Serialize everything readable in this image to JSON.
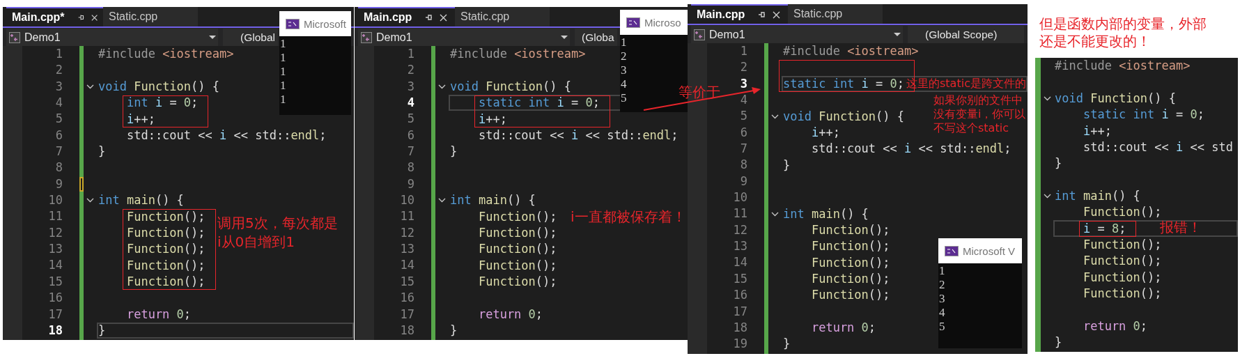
{
  "panels": [
    {
      "kind": "editor",
      "tabs": [
        {
          "label": "Main.cpp*",
          "selected": true
        },
        {
          "label": "Static.cpp",
          "selected": false
        }
      ],
      "project": "Demo1",
      "scope": "(Global",
      "console": {
        "title": "Microsoft",
        "output": [
          "1",
          "1",
          "1",
          "1",
          "1"
        ]
      },
      "lines": [
        {
          "number": "1",
          "current": false,
          "fold": false,
          "boxed": false,
          "unsaved": false,
          "tokens": [
            {
              "kind": "preprocessor",
              "text": "#include "
            },
            {
              "kind": "string",
              "text": "<iostream>"
            }
          ]
        },
        {
          "number": "2",
          "current": false,
          "fold": false,
          "boxed": false,
          "unsaved": false
        },
        {
          "number": "3",
          "current": false,
          "fold": true,
          "boxed": false,
          "unsaved": false,
          "tokens": [
            {
              "kind": "keyword",
              "text": "void "
            },
            {
              "kind": "function",
              "text": "Function"
            },
            {
              "kind": "plain",
              "text": "() {"
            }
          ]
        },
        {
          "number": "4",
          "current": false,
          "fold": false,
          "boxed": true,
          "unsaved": false,
          "tokens": [
            {
              "kind": "keyword",
              "text": "    int "
            },
            {
              "kind": "variable",
              "text": "i"
            },
            {
              "kind": "plain",
              "text": " = "
            },
            {
              "kind": "number",
              "text": "0"
            },
            {
              "kind": "plain",
              "text": ";"
            }
          ]
        },
        {
          "number": "5",
          "current": false,
          "fold": false,
          "boxed": true,
          "unsaved": false,
          "tokens": [
            {
              "kind": "variable",
              "text": "    i"
            },
            {
              "kind": "plain",
              "text": "++;"
            }
          ]
        },
        {
          "number": "6",
          "current": false,
          "fold": false,
          "boxed": false,
          "unsaved": false,
          "tokens": [
            {
              "kind": "plain",
              "text": "    std::cout << "
            },
            {
              "kind": "variable",
              "text": "i"
            },
            {
              "kind": "plain",
              "text": " << std::"
            },
            {
              "kind": "function",
              "text": "endl"
            },
            {
              "kind": "plain",
              "text": ";"
            }
          ]
        },
        {
          "number": "7",
          "current": false,
          "fold": false,
          "boxed": false,
          "unsaved": false,
          "tokens": [
            {
              "kind": "plain",
              "text": "}"
            }
          ]
        },
        {
          "number": "8",
          "current": false,
          "fold": false,
          "boxed": false,
          "unsaved": false
        },
        {
          "number": "9",
          "current": false,
          "fold": false,
          "boxed": false,
          "unsaved": true
        },
        {
          "number": "10",
          "current": false,
          "fold": true,
          "boxed": false,
          "unsaved": false,
          "tokens": [
            {
              "kind": "keyword",
              "text": "int "
            },
            {
              "kind": "function",
              "text": "main"
            },
            {
              "kind": "plain",
              "text": "() {"
            }
          ]
        },
        {
          "number": "11",
          "current": false,
          "fold": false,
          "boxed": true,
          "unsaved": false,
          "tokens": [
            {
              "kind": "function",
              "text": "    Function"
            },
            {
              "kind": "plain",
              "text": "();"
            }
          ],
          "note": "调用5次，每次都是i从0自增到1"
        },
        {
          "number": "12",
          "current": false,
          "fold": false,
          "boxed": true,
          "unsaved": false,
          "tokens": [
            {
              "kind": "function",
              "text": "    Function"
            },
            {
              "kind": "plain",
              "text": "();"
            }
          ]
        },
        {
          "number": "13",
          "current": false,
          "fold": false,
          "boxed": true,
          "unsaved": false,
          "tokens": [
            {
              "kind": "function",
              "text": "    Function"
            },
            {
              "kind": "plain",
              "text": "();"
            }
          ]
        },
        {
          "number": "14",
          "current": false,
          "fold": false,
          "boxed": true,
          "unsaved": false,
          "tokens": [
            {
              "kind": "function",
              "text": "    Function"
            },
            {
              "kind": "plain",
              "text": "();"
            }
          ]
        },
        {
          "number": "15",
          "current": false,
          "fold": false,
          "boxed": true,
          "unsaved": false,
          "tokens": [
            {
              "kind": "function",
              "text": "    Function"
            },
            {
              "kind": "plain",
              "text": "();"
            }
          ]
        },
        {
          "number": "16",
          "current": false,
          "fold": false,
          "boxed": false,
          "unsaved": false
        },
        {
          "number": "17",
          "current": false,
          "fold": false,
          "boxed": false,
          "unsaved": false,
          "tokens": [
            {
              "kind": "control",
              "text": "    return "
            },
            {
              "kind": "number",
              "text": "0"
            },
            {
              "kind": "plain",
              "text": ";"
            }
          ]
        },
        {
          "number": "18",
          "current": true,
          "fold": false,
          "boxed": false,
          "unsaved": false,
          "tokens": [
            {
              "kind": "plain",
              "text": "}"
            }
          ]
        }
      ]
    },
    {
      "kind": "editor",
      "tabs": [
        {
          "label": "Main.cpp",
          "selected": true
        },
        {
          "label": "Static.cpp",
          "selected": false
        }
      ],
      "project": "Demo1",
      "scope": "(Globa",
      "console": {
        "title": "Microso",
        "output": [
          "1",
          "2",
          "3",
          "4",
          "5"
        ]
      },
      "lines": [
        {
          "number": "1",
          "current": false,
          "fold": false,
          "boxed": false,
          "unsaved": false,
          "tokens": [
            {
              "kind": "preprocessor",
              "text": "#include "
            },
            {
              "kind": "string",
              "text": "<iostream>"
            }
          ]
        },
        {
          "number": "2",
          "current": false,
          "fold": false,
          "boxed": false,
          "unsaved": false
        },
        {
          "number": "3",
          "current": false,
          "fold": true,
          "boxed": false,
          "unsaved": false,
          "tokens": [
            {
              "kind": "keyword",
              "text": "void "
            },
            {
              "kind": "function",
              "text": "Function"
            },
            {
              "kind": "plain",
              "text": "() {"
            }
          ]
        },
        {
          "number": "4",
          "current": true,
          "fold": false,
          "boxed": true,
          "unsaved": false,
          "tokens": [
            {
              "kind": "keyword",
              "text": "    static int "
            },
            {
              "kind": "variable",
              "text": "i"
            },
            {
              "kind": "plain",
              "text": " = "
            },
            {
              "kind": "number",
              "text": "0"
            },
            {
              "kind": "plain",
              "text": ";"
            }
          ]
        },
        {
          "number": "5",
          "current": false,
          "fold": false,
          "boxed": true,
          "unsaved": false,
          "tokens": [
            {
              "kind": "variable",
              "text": "    i"
            },
            {
              "kind": "plain",
              "text": "++;"
            }
          ]
        },
        {
          "number": "6",
          "current": false,
          "fold": false,
          "boxed": false,
          "unsaved": false,
          "tokens": [
            {
              "kind": "plain",
              "text": "    std::cout << "
            },
            {
              "kind": "variable",
              "text": "i"
            },
            {
              "kind": "plain",
              "text": " << std::"
            },
            {
              "kind": "function",
              "text": "endl"
            },
            {
              "kind": "plain",
              "text": ";"
            }
          ]
        },
        {
          "number": "7",
          "current": false,
          "fold": false,
          "boxed": false,
          "unsaved": false,
          "tokens": [
            {
              "kind": "plain",
              "text": "}"
            }
          ]
        },
        {
          "number": "8",
          "current": false,
          "fold": false,
          "boxed": false,
          "unsaved": false
        },
        {
          "number": "9",
          "current": false,
          "fold": false,
          "boxed": false,
          "unsaved": false
        },
        {
          "number": "10",
          "current": false,
          "fold": true,
          "boxed": false,
          "unsaved": false,
          "tokens": [
            {
              "kind": "keyword",
              "text": "int "
            },
            {
              "kind": "function",
              "text": "main"
            },
            {
              "kind": "plain",
              "text": "() {"
            }
          ]
        },
        {
          "number": "11",
          "current": false,
          "fold": false,
          "boxed": false,
          "unsaved": false,
          "tokens": [
            {
              "kind": "function",
              "text": "    Function"
            },
            {
              "kind": "plain",
              "text": "();"
            }
          ],
          "note": "i一直都被保存着！"
        },
        {
          "number": "12",
          "current": false,
          "fold": false,
          "boxed": false,
          "unsaved": false,
          "tokens": [
            {
              "kind": "function",
              "text": "    Function"
            },
            {
              "kind": "plain",
              "text": "();"
            }
          ]
        },
        {
          "number": "13",
          "current": false,
          "fold": false,
          "boxed": false,
          "unsaved": false,
          "tokens": [
            {
              "kind": "function",
              "text": "    Function"
            },
            {
              "kind": "plain",
              "text": "();"
            }
          ]
        },
        {
          "number": "14",
          "current": false,
          "fold": false,
          "boxed": false,
          "unsaved": false,
          "tokens": [
            {
              "kind": "function",
              "text": "    Function"
            },
            {
              "kind": "plain",
              "text": "();"
            }
          ]
        },
        {
          "number": "15",
          "current": false,
          "fold": false,
          "boxed": false,
          "unsaved": false,
          "tokens": [
            {
              "kind": "function",
              "text": "    Function"
            },
            {
              "kind": "plain",
              "text": "();"
            }
          ]
        },
        {
          "number": "16",
          "current": false,
          "fold": false,
          "boxed": false,
          "unsaved": false
        },
        {
          "number": "17",
          "current": false,
          "fold": false,
          "boxed": false,
          "unsaved": false,
          "tokens": [
            {
              "kind": "control",
              "text": "    return "
            },
            {
              "kind": "number",
              "text": "0"
            },
            {
              "kind": "plain",
              "text": ";"
            }
          ]
        },
        {
          "number": "18",
          "current": false,
          "fold": false,
          "boxed": false,
          "unsaved": false,
          "tokens": [
            {
              "kind": "plain",
              "text": "}"
            }
          ]
        }
      ]
    },
    {
      "kind": "editor",
      "tabs": [
        {
          "label": "Main.cpp",
          "selected": true
        },
        {
          "label": "Static.cpp",
          "selected": false
        }
      ],
      "project": "Demo1",
      "scope": "(Global Scope)",
      "console": {
        "title": "Microsoft V",
        "output": [
          "1",
          "2",
          "3",
          "4",
          "5"
        ]
      },
      "lines": [
        {
          "number": "1",
          "current": false,
          "fold": false,
          "boxed": false,
          "unsaved": false,
          "tokens": [
            {
              "kind": "preprocessor",
              "text": "#include "
            },
            {
              "kind": "string",
              "text": "<iostream>"
            }
          ]
        },
        {
          "number": "2",
          "current": false,
          "fold": false,
          "boxed": true,
          "unsaved": false
        },
        {
          "number": "3",
          "current": true,
          "fold": false,
          "boxed": true,
          "unsaved": false,
          "tokens": [
            {
              "kind": "keyword",
              "text": "static int "
            },
            {
              "kind": "variable",
              "text": "i"
            },
            {
              "kind": "plain",
              "text": " = "
            },
            {
              "kind": "number",
              "text": "0"
            },
            {
              "kind": "plain",
              "text": ";"
            }
          ],
          "note": "这里的static是跨文件的"
        },
        {
          "number": "4",
          "current": false,
          "fold": false,
          "boxed": false,
          "unsaved": false,
          "note": "如果你别的文件中没有变量i，你可以不写这个static"
        },
        {
          "number": "5",
          "current": false,
          "fold": true,
          "boxed": false,
          "unsaved": false,
          "tokens": [
            {
              "kind": "keyword",
              "text": "void "
            },
            {
              "kind": "function",
              "text": "Function"
            },
            {
              "kind": "plain",
              "text": "() {"
            }
          ]
        },
        {
          "number": "6",
          "current": false,
          "fold": false,
          "boxed": false,
          "unsaved": false,
          "tokens": [
            {
              "kind": "variable",
              "text": "    i"
            },
            {
              "kind": "plain",
              "text": "++;"
            }
          ]
        },
        {
          "number": "7",
          "current": false,
          "fold": false,
          "boxed": false,
          "unsaved": false,
          "tokens": [
            {
              "kind": "plain",
              "text": "    std::cout << "
            },
            {
              "kind": "variable",
              "text": "i"
            },
            {
              "kind": "plain",
              "text": " << std::"
            },
            {
              "kind": "function",
              "text": "endl"
            },
            {
              "kind": "plain",
              "text": ";"
            }
          ]
        },
        {
          "number": "8",
          "current": false,
          "fold": false,
          "boxed": false,
          "unsaved": false,
          "tokens": [
            {
              "kind": "plain",
              "text": "}"
            }
          ]
        },
        {
          "number": "9",
          "current": false,
          "fold": false,
          "boxed": false,
          "unsaved": false
        },
        {
          "number": "10",
          "current": false,
          "fold": false,
          "boxed": false,
          "unsaved": false
        },
        {
          "number": "11",
          "current": false,
          "fold": true,
          "boxed": false,
          "unsaved": false,
          "tokens": [
            {
              "kind": "keyword",
              "text": "int "
            },
            {
              "kind": "function",
              "text": "main"
            },
            {
              "kind": "plain",
              "text": "() {"
            }
          ]
        },
        {
          "number": "12",
          "current": false,
          "fold": false,
          "boxed": false,
          "unsaved": false,
          "tokens": [
            {
              "kind": "function",
              "text": "    Function"
            },
            {
              "kind": "plain",
              "text": "();"
            }
          ]
        },
        {
          "number": "13",
          "current": false,
          "fold": false,
          "boxed": false,
          "unsaved": false,
          "tokens": [
            {
              "kind": "function",
              "text": "    Function"
            },
            {
              "kind": "plain",
              "text": "();"
            }
          ]
        },
        {
          "number": "14",
          "current": false,
          "fold": false,
          "boxed": false,
          "unsaved": false,
          "tokens": [
            {
              "kind": "function",
              "text": "    Function"
            },
            {
              "kind": "plain",
              "text": "();"
            }
          ]
        },
        {
          "number": "15",
          "current": false,
          "fold": false,
          "boxed": false,
          "unsaved": false,
          "tokens": [
            {
              "kind": "function",
              "text": "    Function"
            },
            {
              "kind": "plain",
              "text": "();"
            }
          ]
        },
        {
          "number": "16",
          "current": false,
          "fold": false,
          "boxed": false,
          "unsaved": false,
          "tokens": [
            {
              "kind": "function",
              "text": "    Function"
            },
            {
              "kind": "plain",
              "text": "();"
            }
          ]
        },
        {
          "number": "17",
          "current": false,
          "fold": false,
          "boxed": false,
          "unsaved": false
        },
        {
          "number": "18",
          "current": false,
          "fold": false,
          "boxed": false,
          "unsaved": false,
          "tokens": [
            {
              "kind": "control",
              "text": "    return "
            },
            {
              "kind": "number",
              "text": "0"
            },
            {
              "kind": "plain",
              "text": ";"
            }
          ]
        },
        {
          "number": "19",
          "current": false,
          "fold": false,
          "boxed": false,
          "unsaved": false,
          "tokens": [
            {
              "kind": "plain",
              "text": "}"
            }
          ]
        }
      ]
    },
    {
      "kind": "snippet",
      "caption": "但是函数内部的变量，外部还是不能更改的！",
      "lines": [
        {
          "current": false,
          "fold": false,
          "boxed": false,
          "unsaved": false,
          "tokens": [
            {
              "kind": "preprocessor",
              "text": "#include "
            },
            {
              "kind": "string",
              "text": "<iostream>"
            }
          ]
        },
        {
          "current": false,
          "fold": false,
          "boxed": false,
          "unsaved": false
        },
        {
          "current": false,
          "fold": true,
          "boxed": false,
          "unsaved": false,
          "tokens": [
            {
              "kind": "keyword",
              "text": "void "
            },
            {
              "kind": "function",
              "text": "Function"
            },
            {
              "kind": "plain",
              "text": "() {"
            }
          ]
        },
        {
          "current": false,
          "fold": false,
          "boxed": false,
          "unsaved": false,
          "tokens": [
            {
              "kind": "keyword",
              "text": "    static int "
            },
            {
              "kind": "variable",
              "text": "i"
            },
            {
              "kind": "plain",
              "text": " = "
            },
            {
              "kind": "number",
              "text": "0"
            },
            {
              "kind": "plain",
              "text": ";"
            }
          ]
        },
        {
          "current": false,
          "fold": false,
          "boxed": false,
          "unsaved": false,
          "tokens": [
            {
              "kind": "variable",
              "text": "    i"
            },
            {
              "kind": "plain",
              "text": "++;"
            }
          ]
        },
        {
          "current": false,
          "fold": false,
          "boxed": false,
          "unsaved": false,
          "tokens": [
            {
              "kind": "plain",
              "text": "    std::cout << "
            },
            {
              "kind": "variable",
              "text": "i"
            },
            {
              "kind": "plain",
              "text": " << std"
            }
          ]
        },
        {
          "current": false,
          "fold": false,
          "boxed": false,
          "unsaved": false,
          "tokens": [
            {
              "kind": "plain",
              "text": "}"
            }
          ]
        },
        {
          "current": false,
          "fold": false,
          "boxed": false,
          "unsaved": false
        },
        {
          "current": false,
          "fold": true,
          "boxed": false,
          "unsaved": false,
          "tokens": [
            {
              "kind": "keyword",
              "text": "int "
            },
            {
              "kind": "function",
              "text": "main"
            },
            {
              "kind": "plain",
              "text": "() {"
            }
          ]
        },
        {
          "current": false,
          "fold": false,
          "boxed": false,
          "unsaved": false,
          "tokens": [
            {
              "kind": "function",
              "text": "    Function"
            },
            {
              "kind": "plain",
              "text": "();"
            }
          ]
        },
        {
          "current": true,
          "fold": false,
          "boxed": true,
          "unsaved": false,
          "tokens": [
            {
              "kind": "variable",
              "text": "    i"
            },
            {
              "kind": "plain",
              "text": " = "
            },
            {
              "kind": "number",
              "text": "8"
            },
            {
              "kind": "plain",
              "text": ";"
            }
          ],
          "note": "报错！"
        },
        {
          "current": false,
          "fold": false,
          "boxed": false,
          "unsaved": false,
          "tokens": [
            {
              "kind": "function",
              "text": "    Function"
            },
            {
              "kind": "plain",
              "text": "();"
            }
          ]
        },
        {
          "current": false,
          "fold": false,
          "boxed": false,
          "unsaved": false,
          "tokens": [
            {
              "kind": "function",
              "text": "    Function"
            },
            {
              "kind": "plain",
              "text": "();"
            }
          ]
        },
        {
          "current": false,
          "fold": false,
          "boxed": false,
          "unsaved": false,
          "tokens": [
            {
              "kind": "function",
              "text": "    Function"
            },
            {
              "kind": "plain",
              "text": "();"
            }
          ]
        },
        {
          "current": false,
          "fold": false,
          "boxed": false,
          "unsaved": false,
          "tokens": [
            {
              "kind": "function",
              "text": "    Function"
            },
            {
              "kind": "plain",
              "text": "();"
            }
          ]
        },
        {
          "current": false,
          "fold": false,
          "boxed": false,
          "unsaved": false
        },
        {
          "current": false,
          "fold": false,
          "boxed": false,
          "unsaved": false,
          "tokens": [
            {
              "kind": "control",
              "text": "    return "
            },
            {
              "kind": "number",
              "text": "0"
            },
            {
              "kind": "plain",
              "text": ";"
            }
          ]
        },
        {
          "current": false,
          "fold": false,
          "boxed": false,
          "unsaved": false,
          "tokens": [
            {
              "kind": "plain",
              "text": "}"
            }
          ]
        }
      ]
    }
  ],
  "bridge": {
    "text": "等价于"
  }
}
